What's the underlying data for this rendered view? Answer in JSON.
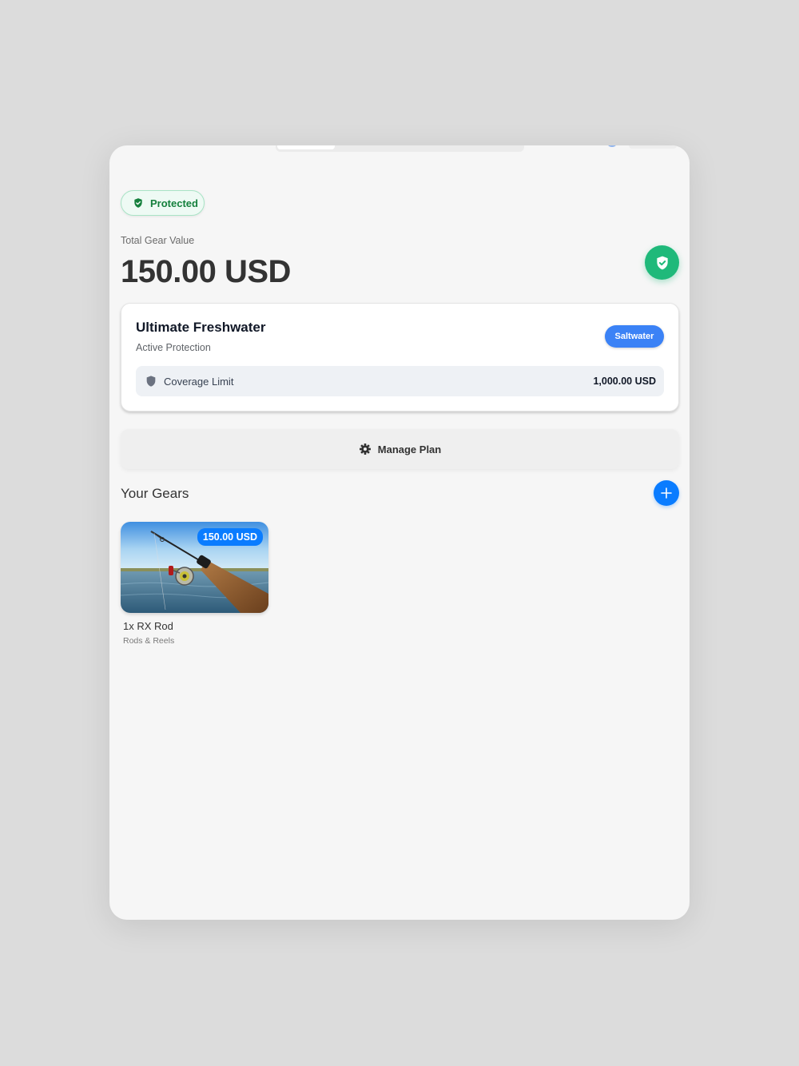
{
  "status": {
    "label": "Protected"
  },
  "summary": {
    "label": "Total Gear Value",
    "amount": "150.00 USD"
  },
  "plan": {
    "title": "Ultimate Freshwater",
    "subtitle": "Active Protection",
    "switch_label": "Saltwater",
    "coverage_label": "Coverage Limit",
    "coverage_value": "1,000.00 USD"
  },
  "actions": {
    "manage_label": "Manage Plan"
  },
  "gears": {
    "title": "Your Gears",
    "items": [
      {
        "name": "1x RX Rod",
        "category": "Rods & Reels",
        "price": "150.00 USD"
      }
    ]
  },
  "colors": {
    "accent": "#0a7cff",
    "protected_green": "#1fb97a",
    "switch_blue": "#3b82f6",
    "background": "#f6f6f6"
  },
  "icons": {
    "status": "shield-check-icon",
    "header": "shield-check-icon",
    "coverage": "shield-icon",
    "manage": "gear-icon",
    "add": "plus-icon"
  }
}
